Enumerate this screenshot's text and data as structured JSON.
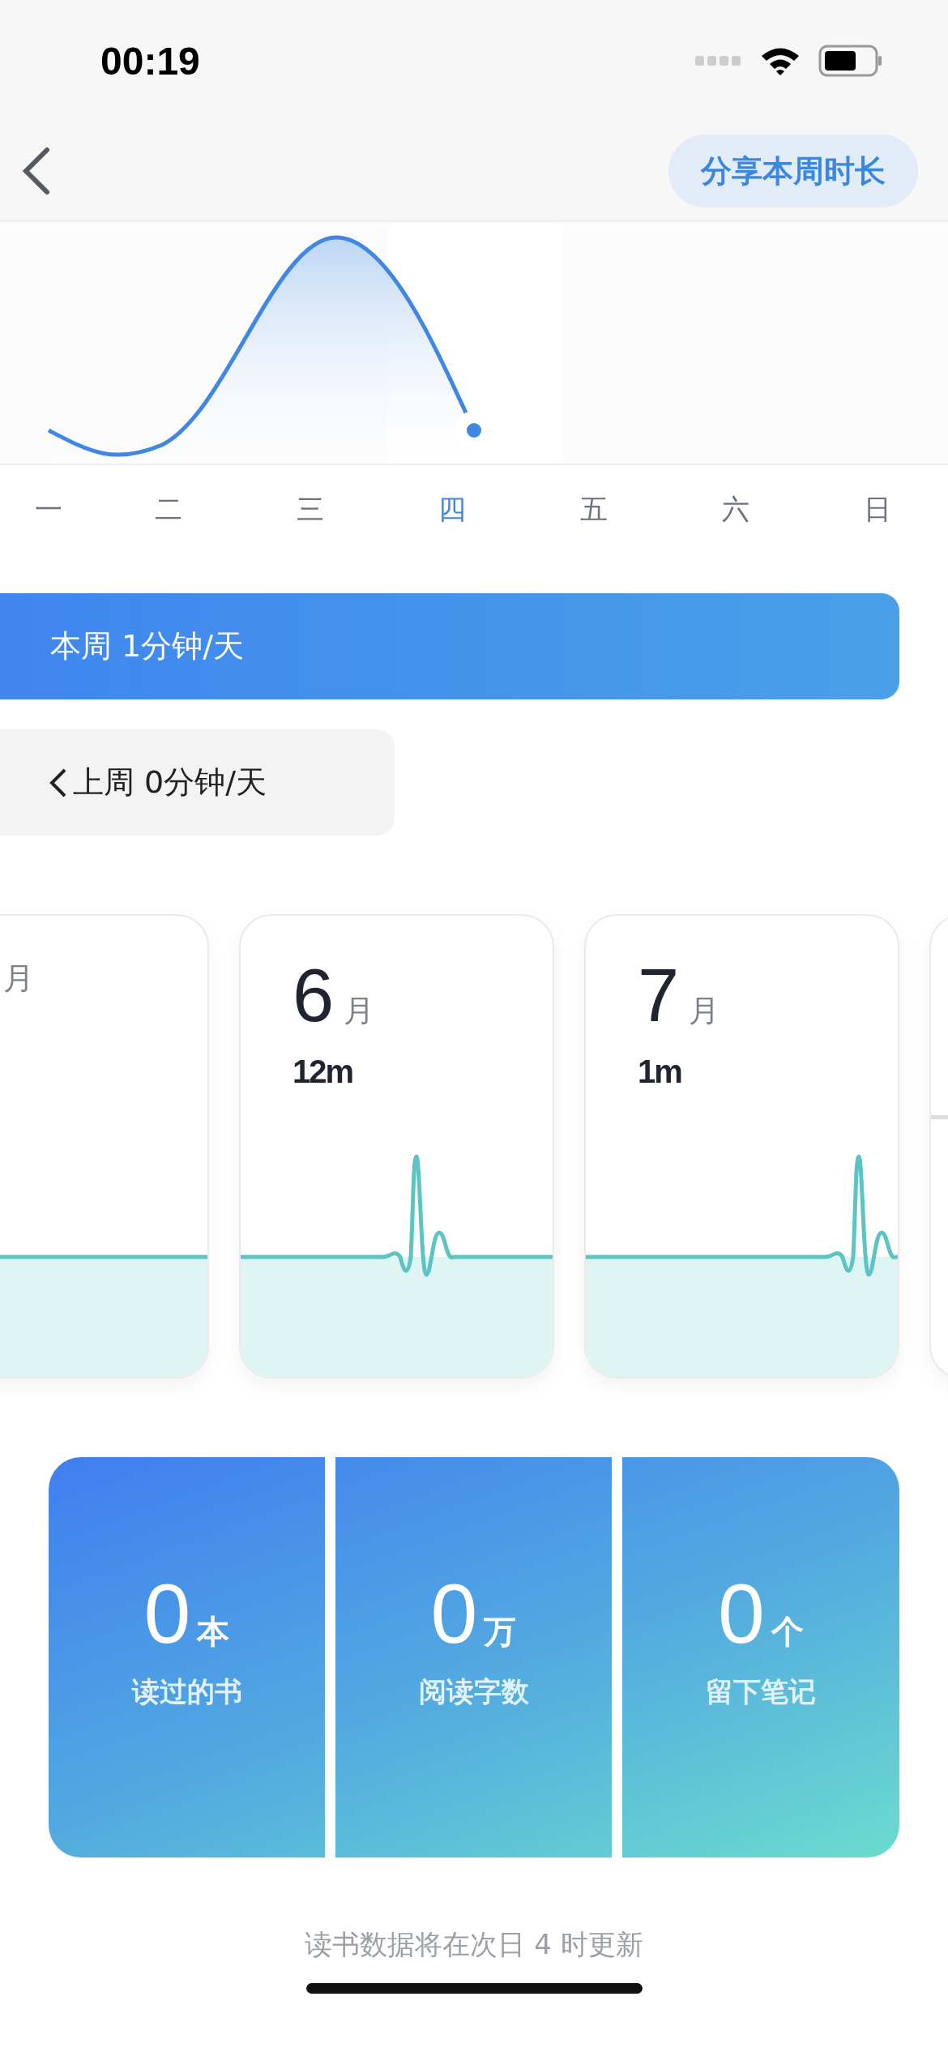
{
  "status_bar": {
    "time": "00:19"
  },
  "nav": {
    "share_button": "分享本周时长"
  },
  "week_chart": {
    "days": [
      {
        "label": "一",
        "selected": false
      },
      {
        "label": "二",
        "selected": false
      },
      {
        "label": "三",
        "selected": false
      },
      {
        "label": "四",
        "selected": true
      },
      {
        "label": "五",
        "selected": false
      },
      {
        "label": "六",
        "selected": false
      },
      {
        "label": "日",
        "selected": false
      }
    ]
  },
  "this_week": "本周 1分钟/天",
  "last_week": "上周 0分钟/天",
  "month_cards": [
    {
      "unit": "月"
    },
    {
      "month": "6",
      "unit": "月",
      "duration": "12m"
    },
    {
      "month": "7",
      "unit": "月",
      "duration": "1m"
    }
  ],
  "stats": [
    {
      "value": "0",
      "unit": "本",
      "label": "读过的书"
    },
    {
      "value": "0",
      "unit": "万",
      "label": "阅读字数"
    },
    {
      "value": "0",
      "unit": "个",
      "label": "留下笔记"
    }
  ],
  "footer": "读书数据将在次日 4 时更新"
}
